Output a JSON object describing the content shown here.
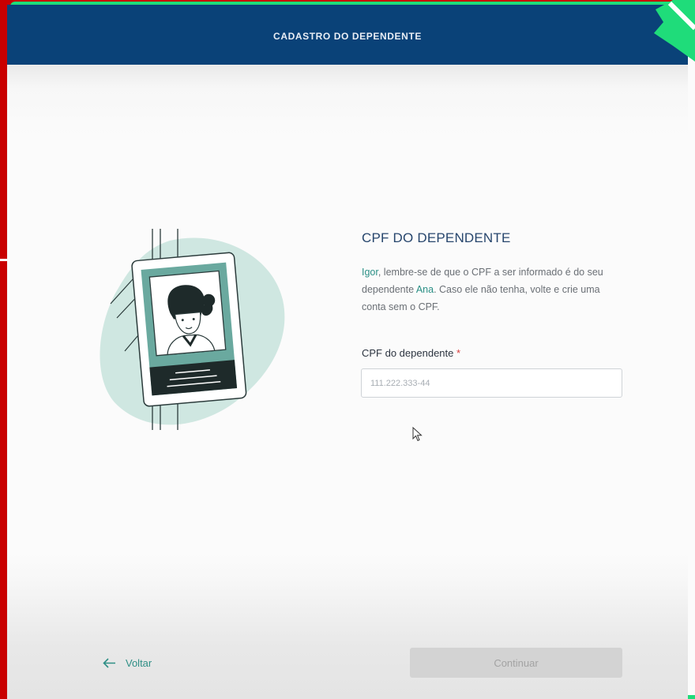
{
  "header": {
    "title": "CADASTRO DO DEPENDENTE"
  },
  "section": {
    "title": "CPF DO DEPENDENTE",
    "description": {
      "name_user": "Igor",
      "part1": ", lembre-se de que o CPF a ser informado é do seu dependente ",
      "name_dependent": "Ana",
      "part2": ". Caso ele não tenha, volte e crie uma conta sem o CPF."
    }
  },
  "form": {
    "cpf_label": "CPF do dependente",
    "required_mark": "*",
    "cpf_placeholder": "111.222.333-44",
    "cpf_value": ""
  },
  "footer": {
    "back_label": "Voltar",
    "continue_label": "Continuar"
  },
  "colors": {
    "header": "#0a4278",
    "accent": "#2a8f85",
    "frame_border": "#1fdc7a",
    "outer_background": "#c90000"
  },
  "icons": {
    "back": "arrow-left-icon",
    "corner": "corner-badge-icon",
    "pointer": "mouse-cursor-icon"
  }
}
